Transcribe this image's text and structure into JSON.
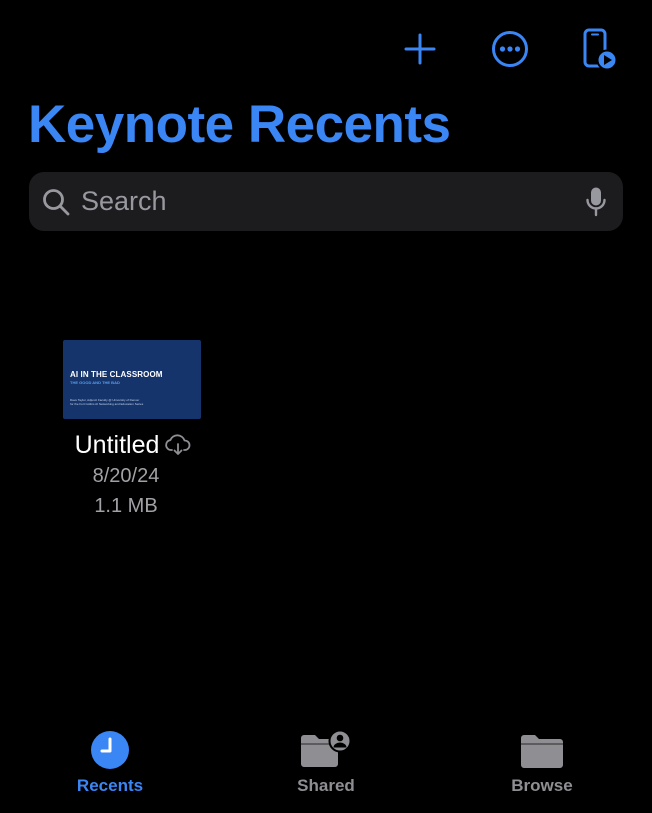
{
  "toolbar": {
    "add_icon": "plus-icon",
    "more_icon": "ellipsis-circle-icon",
    "present_icon": "phone-play-icon"
  },
  "header": {
    "title": "Keynote Recents"
  },
  "search": {
    "placeholder": "Search",
    "value": ""
  },
  "documents": [
    {
      "name": "Untitled",
      "date": "8/20/24",
      "size": "1.1 MB",
      "status_icon": "icloud-download-icon",
      "thumbnail": {
        "background": "#14346b",
        "title": "AI IN THE CLASSROOM",
        "subtitle": "THE GOOD AND THE BAD",
        "line1": "Dave Taylor, Adjunct Faculty @ University of Denver",
        "line2": "for the Fort Collins AI Networking and Education Series"
      }
    }
  ],
  "tabs": [
    {
      "label": "Recents",
      "icon": "clock-icon",
      "active": true
    },
    {
      "label": "Shared",
      "icon": "shared-folder-icon",
      "active": false
    },
    {
      "label": "Browse",
      "icon": "folder-icon",
      "active": false
    }
  ],
  "colors": {
    "accent": "#3a86f4",
    "inactive": "#8e8e93",
    "background": "#000000",
    "search_field": "#1c1c1e"
  }
}
